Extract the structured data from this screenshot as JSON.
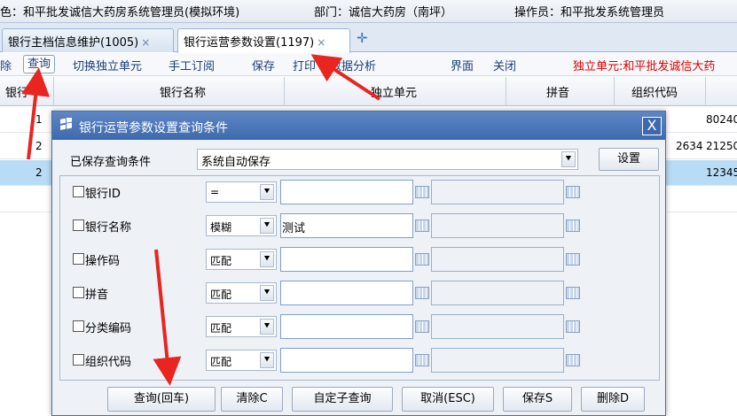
{
  "statusbar": {
    "system": "色：和平批发诚信大药房系统管理员(模拟环境)",
    "department": "部门：诚信大药房（南坪）",
    "operator": "操作员：和平批发系统管理员"
  },
  "tabs": [
    {
      "label": "银行主档信息维护(1005)",
      "close": "×"
    },
    {
      "label": "银行运营参数设置(1197)",
      "close": "×"
    }
  ],
  "toolbar": {
    "delete": "除",
    "query": "查询",
    "switch_unit": "切换独立单元",
    "manual_order": "手工订阅",
    "save": "保存",
    "print": "打印",
    "data_analysis": "数据分析",
    "interface": "界面",
    "close": "关闭",
    "unit_info": "独立单元:和平批发诚信大药"
  },
  "grid": {
    "headers": [
      "银行",
      "银行名称",
      "独立单元",
      "拼音",
      "组织代码"
    ],
    "rows": [
      {
        "col0": "1",
        "right": "80240"
      },
      {
        "col0": "2",
        "mid": "2634",
        "right": "21250"
      },
      {
        "col0": "2",
        "right": "12345"
      }
    ]
  },
  "dialog": {
    "title": "银行运营参数设置查询条件",
    "close": "X",
    "saved_label": "已保存查询条件",
    "saved_value": "系统自动保存",
    "settings_button": "设置",
    "conditions": [
      {
        "label": "银行ID",
        "operator": "=",
        "value": ""
      },
      {
        "label": "银行名称",
        "operator": "模糊",
        "value": "测试"
      },
      {
        "label": "操作码",
        "operator": "匹配",
        "value": ""
      },
      {
        "label": "拼音",
        "operator": "匹配",
        "value": ""
      },
      {
        "label": "分类编码",
        "operator": "匹配",
        "value": ""
      },
      {
        "label": "组织代码",
        "operator": "匹配",
        "value": ""
      }
    ],
    "buttons": {
      "query": "查询(回车)",
      "clear": "清除C",
      "custom_query": "自定子查询",
      "cancel": "取消(ESC)",
      "save": "保存S",
      "delete": "删除D"
    }
  },
  "colors": {
    "title_bar": "#4a76b8",
    "selected_row": "#b8dcf5",
    "annotation_arrow": "#e8251f",
    "alert_text": "#e00000"
  }
}
